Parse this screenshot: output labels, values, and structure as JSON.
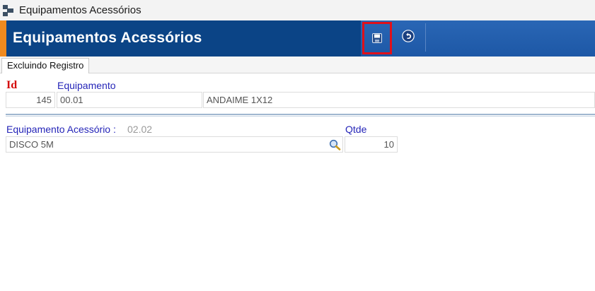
{
  "window": {
    "title": "Equipamentos Acessórios"
  },
  "header": {
    "title": "Equipamentos Acessórios"
  },
  "toolbar": {
    "save_icon": "floppy-disk-icon",
    "back_icon": "undo-arrow-icon"
  },
  "tabs": [
    {
      "label": "Excluindo Registro",
      "active": true
    }
  ],
  "form": {
    "id_label": "Id",
    "equipamento_label": "Equipamento",
    "id_value": "145",
    "equipamento_code": "00.01",
    "equipamento_desc": "ANDAIME 1X12",
    "acessorio_label": "Equipamento Acessório :",
    "acessorio_code": "02.02",
    "acessorio_desc": "DISCO 5M",
    "qtde_label": "Qtde",
    "qtde_value": "10"
  },
  "colors": {
    "header": "#0b4486",
    "accent": "#f08a1e",
    "highlight": "#e0101a"
  }
}
